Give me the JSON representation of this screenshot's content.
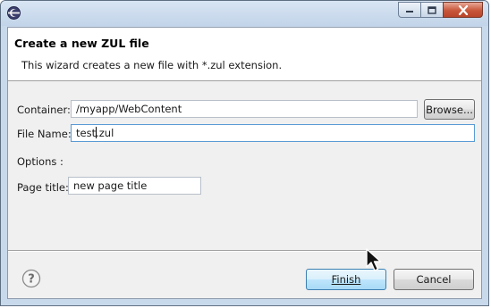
{
  "window": {
    "title": "",
    "icon": "eclipse-icon",
    "buttons": [
      "minimize-icon",
      "maximize-icon",
      "close-icon"
    ]
  },
  "banner": {
    "title": "Create a new ZUL file",
    "description": "This wizard creates a new file with *.zul extension."
  },
  "form": {
    "container_label": "Container:",
    "container_value": "/myapp/WebContent",
    "browse_label": "Browse...",
    "filename_label": "File Name:",
    "filename_before_caret": "test",
    "filename_after_caret": ".zul",
    "options_label": "Options :",
    "page_title_label": "Page title:",
    "page_title_value": "new page title"
  },
  "footer": {
    "help_icon": "help-icon",
    "finish_label": "Finish",
    "cancel_label": "Cancel"
  },
  "colors": {
    "accent": "#3c7fb1",
    "titlebar": "#c9d9ec",
    "close_button": "#c8563a"
  }
}
